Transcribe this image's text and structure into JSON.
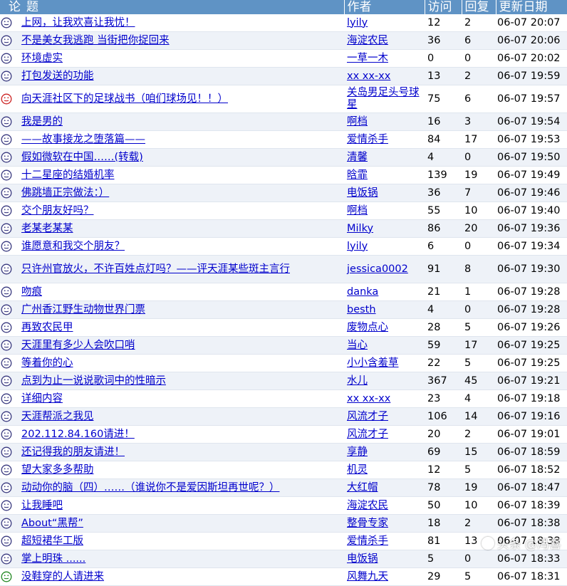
{
  "header": {
    "title": "论题",
    "author": "作者",
    "visits": "访问",
    "replies": "回复",
    "updated": "更新日期"
  },
  "colors": {
    "header_bg": "#5f93c5",
    "link": "#0000cc",
    "face_normal": "#3a3a80",
    "face_red": "#cc2222",
    "face_green": "#228822"
  },
  "threads": [
    {
      "icon": "neutral",
      "title": "上网，让我欢喜让我忧！",
      "author": "lyily",
      "visits": "12",
      "replies": "2",
      "date": "06-07 20:07"
    },
    {
      "icon": "neutral",
      "title": "不是美女我逃跑 当街把你捉回来",
      "author": "海淀农民",
      "visits": "36",
      "replies": "6",
      "date": "06-07 20:06"
    },
    {
      "icon": "neutral",
      "title": "环境虚实",
      "author": "一草一木",
      "visits": "0",
      "replies": "0",
      "date": "06-07 20:02"
    },
    {
      "icon": "neutral",
      "title": "打包发送的功能",
      "author": "xx xx-xx",
      "visits": "13",
      "replies": "2",
      "date": "06-07 19:59"
    },
    {
      "icon": "red",
      "title": "向天涯社区下的足球战书（咱们球场见！！）",
      "author": "关岛男足头号球星",
      "visits": "75",
      "replies": "6",
      "date": "06-07 19:57",
      "tall": true
    },
    {
      "icon": "neutral",
      "title": "我是男的",
      "author": "啊档",
      "visits": "16",
      "replies": "3",
      "date": "06-07 19:54"
    },
    {
      "icon": "neutral",
      "title": "——故事接龙之堕落篇——",
      "author": "爱情杀手",
      "visits": "84",
      "replies": "17",
      "date": "06-07 19:53"
    },
    {
      "icon": "neutral",
      "title": "假如微软在中国……(转载)",
      "author": "清馨",
      "visits": "4",
      "replies": "0",
      "date": "06-07 19:50"
    },
    {
      "icon": "neutral",
      "title": "十二星座的结婚机率",
      "author": "晗霏",
      "visits": "139",
      "replies": "19",
      "date": "06-07 19:49"
    },
    {
      "icon": "neutral",
      "title": "佛跳墙正宗做法：）",
      "author": "电饭锅",
      "visits": "36",
      "replies": "7",
      "date": "06-07 19:46"
    },
    {
      "icon": "neutral",
      "title": "交个朋友好吗？",
      "author": "啊档",
      "visits": "55",
      "replies": "10",
      "date": "06-07 19:40"
    },
    {
      "icon": "neutral",
      "title": "老某老某某",
      "author": "Milky",
      "visits": "86",
      "replies": "20",
      "date": "06-07 19:36"
    },
    {
      "icon": "neutral",
      "title": "谁愿意和我交个朋友？",
      "author": "lyily",
      "visits": "6",
      "replies": "0",
      "date": "06-07 19:34"
    },
    {
      "icon": "neutral",
      "title": "只许州官放火，不许百姓点灯吗？——评天涯某些斑主言行",
      "author": "jessica0002",
      "visits": "91",
      "replies": "8",
      "date": "06-07 19:30",
      "tall": true
    },
    {
      "icon": "neutral",
      "title": "吻痕",
      "author": "danka",
      "visits": "21",
      "replies": "1",
      "date": "06-07 19:28"
    },
    {
      "icon": "neutral",
      "title": "广州香江野生动物世界门票",
      "author": "besth",
      "visits": "4",
      "replies": "0",
      "date": "06-07 19:28"
    },
    {
      "icon": "neutral",
      "title": "再致农民甲",
      "author": "废物点心",
      "visits": "28",
      "replies": "5",
      "date": "06-07 19:26"
    },
    {
      "icon": "neutral",
      "title": "天涯里有多少人会吹口哨",
      "author": "当心",
      "visits": "59",
      "replies": "17",
      "date": "06-07 19:25"
    },
    {
      "icon": "neutral",
      "title": "等着你的心",
      "author": "小小含羞草",
      "visits": "22",
      "replies": "5",
      "date": "06-07 19:25"
    },
    {
      "icon": "neutral",
      "title": "点到为止一说说歌词中的性暗示",
      "author": "水儿",
      "visits": "367",
      "replies": "45",
      "date": "06-07 19:21"
    },
    {
      "icon": "neutral",
      "title": "详细内容",
      "author": "xx xx-xx",
      "visits": "23",
      "replies": "4",
      "date": "06-07 19:18"
    },
    {
      "icon": "neutral",
      "title": "天涯帮派之我见",
      "author": "风流才子",
      "visits": "106",
      "replies": "14",
      "date": "06-07 19:16"
    },
    {
      "icon": "neutral",
      "title": "202.112.84.160请进！",
      "author": "风流才子",
      "visits": "20",
      "replies": "2",
      "date": "06-07 19:01"
    },
    {
      "icon": "neutral",
      "title": "还记得我的朋友请进！",
      "author": "享静",
      "visits": "69",
      "replies": "15",
      "date": "06-07 18:59"
    },
    {
      "icon": "neutral",
      "title": "望大家多多帮助",
      "author": "机灵",
      "visits": "12",
      "replies": "5",
      "date": "06-07 18:52"
    },
    {
      "icon": "neutral",
      "title": "动动你的脑（四）……（谁说你不是爱因斯坦再世呢？）",
      "author": "大红帽",
      "visits": "78",
      "replies": "19",
      "date": "06-07 18:47"
    },
    {
      "icon": "neutral",
      "title": "让我睡吧",
      "author": "海淀农民",
      "visits": "50",
      "replies": "10",
      "date": "06-07 18:39"
    },
    {
      "icon": "neutral",
      "title": "About“黑帮”",
      "author": "整骨专家",
      "visits": "18",
      "replies": "2",
      "date": "06-07 18:38"
    },
    {
      "icon": "neutral",
      "title": "超短裙华工版",
      "author": "爱情杀手",
      "visits": "81",
      "replies": "13",
      "date": "06-07 18:38"
    },
    {
      "icon": "neutral",
      "title": "掌上明珠 ......",
      "author": "电饭锅",
      "visits": "5",
      "replies": "0",
      "date": "06-07 18:33"
    },
    {
      "icon": "green",
      "title": "没鞋穿的人请进来",
      "author": "风舞九天",
      "visits": "29",
      "replies": "5",
      "date": "06-07 18:31"
    }
  ],
  "watermark": {
    "text": "头条 @冯喜"
  }
}
